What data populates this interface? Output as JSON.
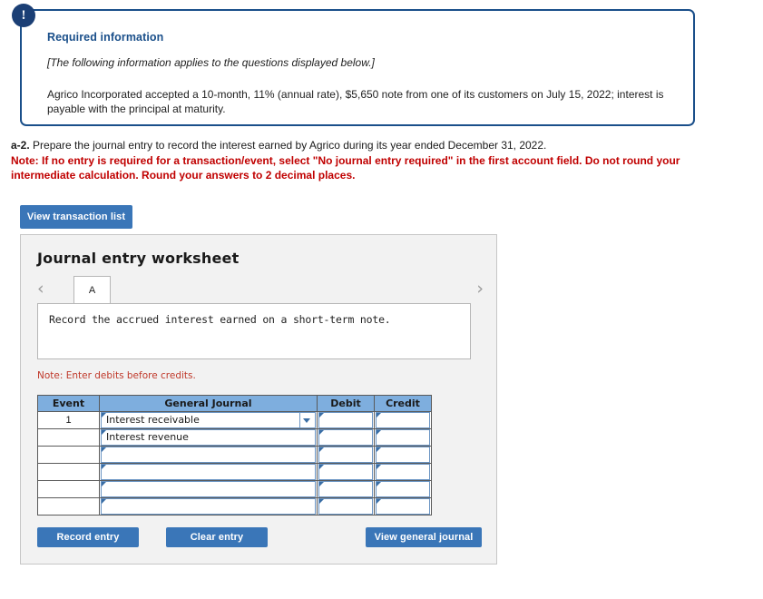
{
  "required_info": {
    "icon": "exclamation-icon",
    "icon_glyph": "!",
    "title": "Required information",
    "subtitle": "[The following information applies to the questions displayed below.]",
    "body": "Agrico Incorporated accepted a 10-month, 11% (annual rate), $5,650 note from one of its customers on July 15, 2022; interest is payable with the principal at maturity.",
    "border_color": "#1a4f8a",
    "title_color": "#1a4f8a"
  },
  "question": {
    "label": "a-2.",
    "text": "Prepare the journal entry to record the interest earned by Agrico during its year ended December 31, 2022.",
    "note": "Note: If no entry is required for a transaction/event, select \"No journal entry required\" in the first account field. Do not round your intermediate calculation. Round your answers to 2 decimal places.",
    "note_color": "#c00000"
  },
  "toolbar": {
    "view_transaction_list_label": "View transaction list",
    "button_color": "#3a76b8"
  },
  "worksheet": {
    "title": "Journal entry worksheet",
    "prev_arrow": "‹",
    "next_arrow": "›",
    "tabs": [
      {
        "label": "A",
        "active": true
      }
    ],
    "description": "Record the accrued interest earned on a short-term note.",
    "debits_note": "Note: Enter debits before credits.",
    "table": {
      "headers": [
        "Event",
        "General Journal",
        "Debit",
        "Credit"
      ],
      "header_color": "#7eaede",
      "rows": [
        {
          "event": "1",
          "account": "Interest receivable",
          "has_dropdown": true,
          "debit": "",
          "credit": ""
        },
        {
          "event": "",
          "account": "Interest revenue",
          "has_dropdown": false,
          "debit": "",
          "credit": ""
        },
        {
          "event": "",
          "account": "",
          "has_dropdown": false,
          "debit": "",
          "credit": ""
        },
        {
          "event": "",
          "account": "",
          "has_dropdown": false,
          "debit": "",
          "credit": ""
        },
        {
          "event": "",
          "account": "",
          "has_dropdown": false,
          "debit": "",
          "credit": ""
        },
        {
          "event": "",
          "account": "",
          "has_dropdown": false,
          "debit": "",
          "credit": ""
        }
      ]
    },
    "buttons": {
      "record_entry": "Record entry",
      "clear_entry": "Clear entry",
      "view_general_journal": "View general journal"
    }
  }
}
